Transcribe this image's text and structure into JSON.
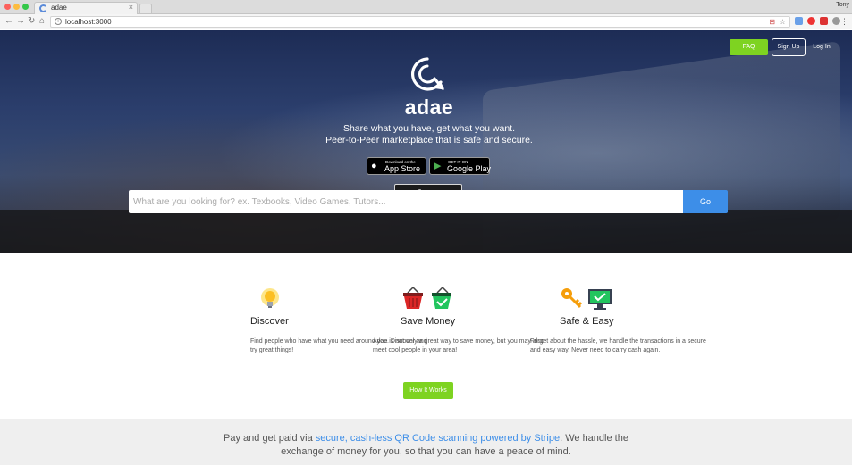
{
  "browser": {
    "tab_title": "adae",
    "tab_close": "×",
    "user_name": "Tony",
    "url": "localhost:3000",
    "nav": {
      "back": "←",
      "forward": "→",
      "reload": "↻",
      "home": "⌂"
    }
  },
  "header": {
    "faq_label": "FAQ",
    "signup_label": "Sign Up",
    "login_label": "Log In"
  },
  "hero": {
    "brand": "adae",
    "tagline_line1": "Share what you have, get what you want.",
    "tagline_line2": "Peer-to-Peer marketplace that is safe and secure.",
    "app_store_small": "Download on the",
    "app_store_big": "App Store",
    "google_play_small": "GET IT ON",
    "google_play_big": "Google Play",
    "browse_label": "Browse"
  },
  "search": {
    "placeholder": "What are you looking for? ex. Texbooks, Video Games, Tutors...",
    "value": "",
    "go_label": "Go"
  },
  "features": [
    {
      "title": "Discover",
      "text": "Find people who have what you need around you. Discover and try great things!",
      "icon": "lightbulb-icon"
    },
    {
      "title": "Save Money",
      "text": "Adae is not only a great way to save money, but you may also meet cool people in your area!",
      "icon": "basket-icon"
    },
    {
      "title": "Safe & Easy",
      "text": "Forget about the hassle, we handle the transactions in a secure and easy way. Never need to carry cash again.",
      "icon": "key-monitor-icon"
    }
  ],
  "how_it_works_label": "How It Works",
  "band": {
    "text_before": "Pay and get paid via ",
    "link_text": "secure, cash-less QR Code scanning powered by Stripe",
    "text_after": ". We handle the exchange of money for you, so that you can have a peace of mind."
  },
  "colors": {
    "green": "#7ed321",
    "blue": "#3d8ee8",
    "hero_dark": "#1d2c55"
  }
}
